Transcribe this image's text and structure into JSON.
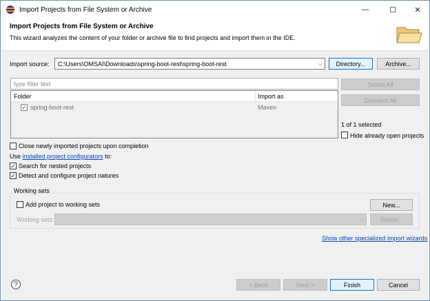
{
  "window": {
    "title": "Import Projects from File System or Archive",
    "controls": {
      "minimize": "—",
      "maximize": "☐",
      "close": "✕"
    }
  },
  "banner": {
    "title": "Import Projects from File System or Archive",
    "description": "This wizard analyzes the content of your folder or archive file to find projects and import them in the IDE."
  },
  "source": {
    "label": "Import source:",
    "value": "C:\\Users\\OMSAI\\Downloads\\spring-boot-rest\\spring-boot-rest",
    "directory_button": "Directory...",
    "archive_button": "Archive..."
  },
  "filter": {
    "placeholder": "type filter text"
  },
  "buttons_side": {
    "select_all": "Select All",
    "deselect_all": "Deselect All"
  },
  "table": {
    "columns": [
      "Folder",
      "Import as"
    ],
    "rows": [
      {
        "folder": "spring-boot-rest",
        "import_as": "Maven",
        "checked": true
      }
    ]
  },
  "selection": {
    "count_text": "1 of 1 selected",
    "hide_open_label": "Hide already open projects"
  },
  "options": {
    "close_label": "Close newly imported projects upon completion",
    "use_prefix": "Use ",
    "use_link": "installed project configurators",
    "use_suffix": " to:",
    "search_nested_label": "Search for nested projects",
    "detect_natures_label": "Detect and configure project natures"
  },
  "working_sets": {
    "legend": "Working sets",
    "add_label": "Add project to working sets",
    "new_button": "New...",
    "sets_label": "Working sets:",
    "select_button": "Select..."
  },
  "show_other_link": "Show other specialized import wizards",
  "footer": {
    "help": "?",
    "back": "< Back",
    "next": "Next >",
    "finish": "Finish",
    "cancel": "Cancel"
  },
  "icons": {
    "check": "✓",
    "dropdown": "⌵"
  }
}
